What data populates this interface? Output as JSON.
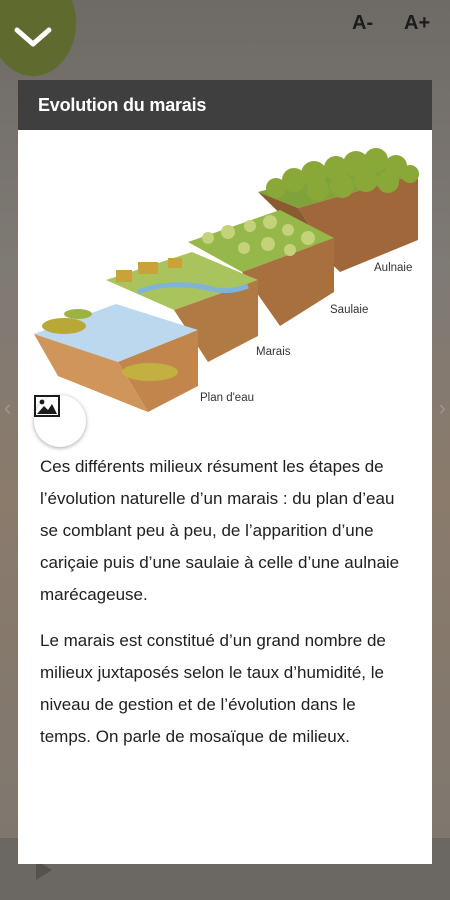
{
  "header": {
    "font_decrease": "A-",
    "font_increase": "A+"
  },
  "card": {
    "title": "Evolution du marais",
    "figure_labels": {
      "plan": "Plan d'eau",
      "marais": "Marais",
      "saulaie": "Saulaie",
      "aulnaie": "Aulnaie"
    },
    "paragraphs": [
      "Ces différents milieux résument les étapes de l’évolution naturelle d’un marais : du plan d’eau se comblant peu à peu, de l’apparition d’une cariçaie puis d’une saulaie à celle d’une aulnaie marécageuse.",
      "Le marais est constitué d’un grand nombre de milieux juxtaposés selon le taux d’humidité, le niveau de gestion et de l’évolution dans le temps. On parle de mosaïque de milieux."
    ]
  },
  "icons": {
    "close": "chevron-down-icon",
    "image": "image-icon"
  },
  "colors": {
    "close_button": "#5f6a2e",
    "header_bar": "#3f3f3f"
  }
}
